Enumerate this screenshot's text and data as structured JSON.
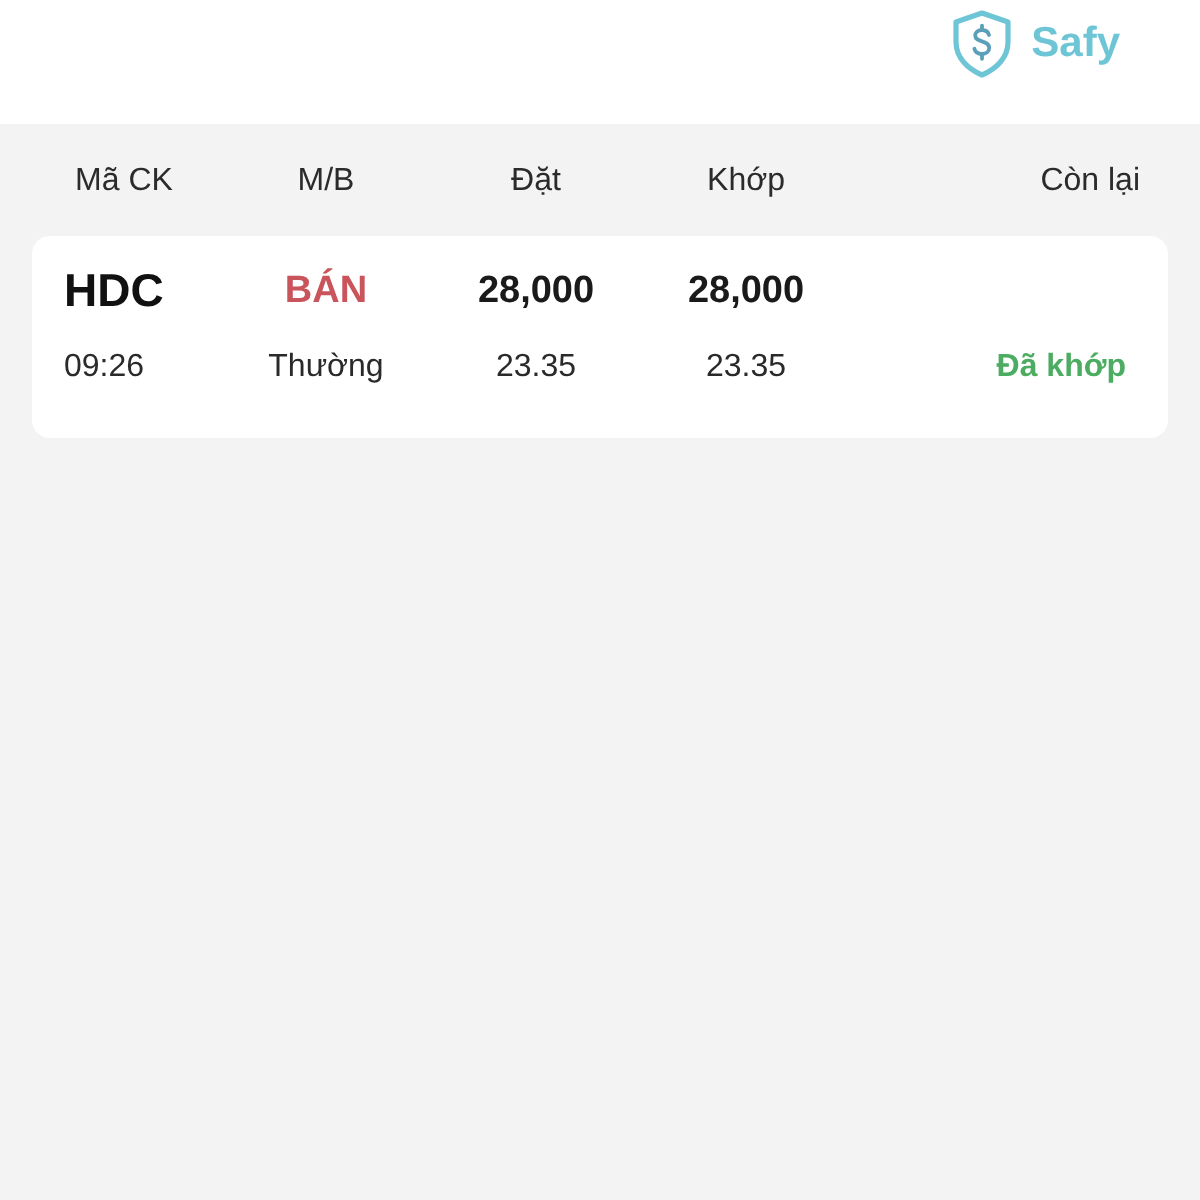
{
  "header": {
    "brand": "Safy"
  },
  "columns": [
    "Mã CK",
    "M/B",
    "Đặt",
    "Khớp",
    "Còn lại"
  ],
  "orders": [
    {
      "symbol": "HDC",
      "time": "09:26",
      "side": {
        "text": "BÁN",
        "kind": "sell"
      },
      "order_type": "Thường",
      "order_quantity": "28,000",
      "order_price": "23.35",
      "match_quantity": "28,000",
      "match_price": "23.35",
      "status": {
        "text": "Đã khớp",
        "kind": "matched"
      }
    }
  ]
}
